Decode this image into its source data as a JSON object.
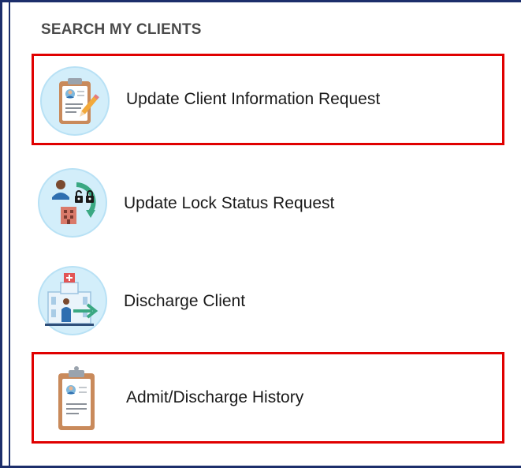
{
  "section": {
    "title": "SEARCH MY CLIENTS"
  },
  "menu": {
    "items": [
      {
        "label": "Update Client Information Request",
        "icon": "clipboard-edit-icon",
        "highlighted": true
      },
      {
        "label": "Update Lock Status Request",
        "icon": "lock-status-icon",
        "highlighted": false
      },
      {
        "label": "Discharge Client",
        "icon": "hospital-exit-icon",
        "highlighted": false
      },
      {
        "label": "Admit/Discharge History",
        "icon": "clipboard-history-icon",
        "highlighted": true
      }
    ]
  },
  "colors": {
    "frame": "#1c2e6b",
    "highlight": "#e00000",
    "icon_circle": "#d3eefa",
    "clipboard": "#c98a5b",
    "accent_green": "#3aa882"
  }
}
